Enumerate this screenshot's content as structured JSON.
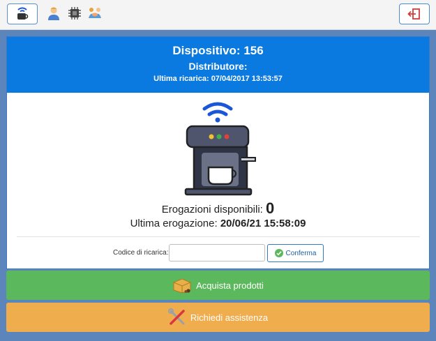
{
  "topbar": {
    "icons": [
      "coffee-wifi-icon",
      "user-icon",
      "chip-icon",
      "handshake-icon"
    ],
    "logout_icon": "exit-icon"
  },
  "device": {
    "title": "Dispositivo: 156",
    "distributor": "Distributore:",
    "last_recharge": "Ultima ricarica: 07/04/2017 13:53:57"
  },
  "stats": {
    "available_label": "Erogazioni disponibili:",
    "available_value": "0",
    "last_label": "Ultima erogazione:",
    "last_value": "20/06/21 15:58:09"
  },
  "recharge": {
    "label": "Codice di ricarica:",
    "value": "",
    "placeholder": "",
    "confirm_label": "Conferma"
  },
  "actions": {
    "buy_label": "Acquista prodotti",
    "help_label": "Richiedi assistenza"
  },
  "colors": {
    "header": "#0b7ae0",
    "buy": "#5cb85c",
    "help": "#f0ad4e",
    "background": "#5b85bb"
  }
}
